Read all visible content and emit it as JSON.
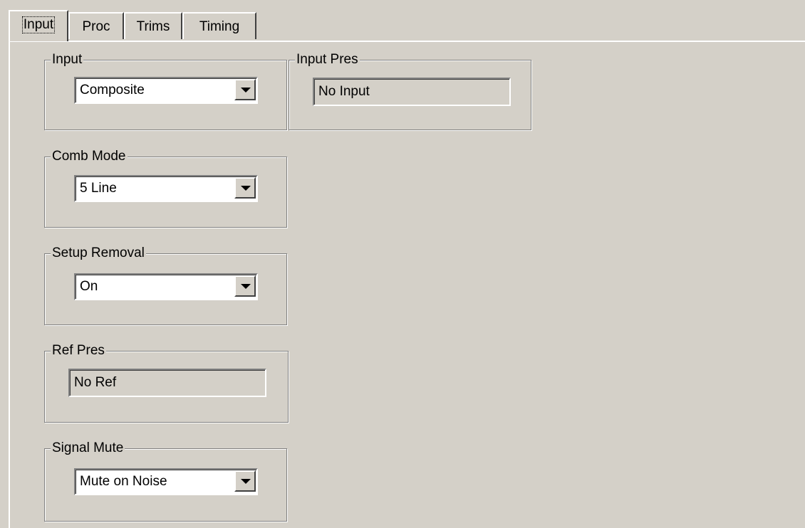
{
  "tabs": [
    {
      "label": "Input",
      "active": true
    },
    {
      "label": "Proc",
      "active": false
    },
    {
      "label": "Trims",
      "active": false
    },
    {
      "label": "Timing",
      "active": false
    }
  ],
  "groups": {
    "input": {
      "label": "Input",
      "value": "Composite"
    },
    "input_pres": {
      "label": "Input Pres",
      "value": "No Input"
    },
    "comb_mode": {
      "label": "Comb Mode",
      "value": "5 Line"
    },
    "setup_removal": {
      "label": "Setup Removal",
      "value": "On"
    },
    "ref_pres": {
      "label": "Ref Pres",
      "value": "No Ref"
    },
    "signal_mute": {
      "label": "Signal Mute",
      "value": "Mute on Noise"
    }
  },
  "icons": {
    "dropdown": "chevron-down-icon"
  }
}
